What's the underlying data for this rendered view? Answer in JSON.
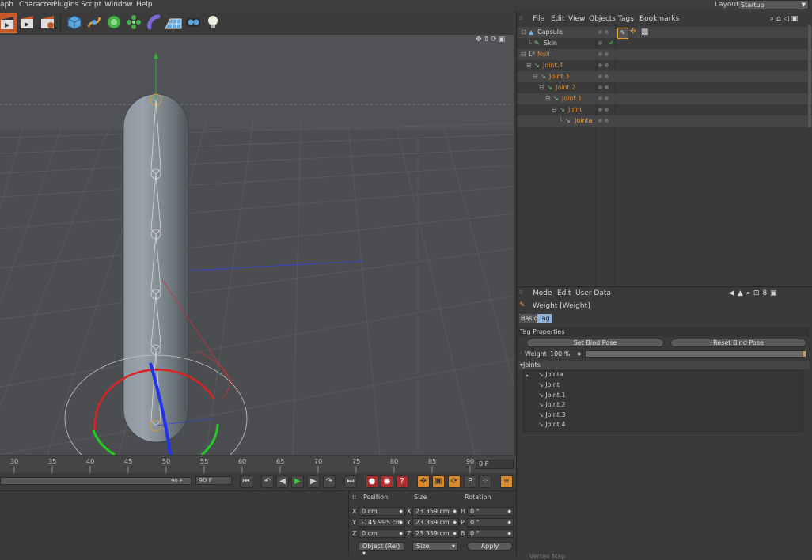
{
  "menubar": {
    "items": [
      "aph",
      "Character",
      "Plugins",
      "Script",
      "Window",
      "Help"
    ],
    "layout_label": "Layout:",
    "layout_value": "Startup"
  },
  "timeline": {
    "ticks": [
      "30",
      "35",
      "40",
      "45",
      "50",
      "55",
      "60",
      "65",
      "70",
      "75",
      "80",
      "85",
      "90"
    ],
    "current_frame": "0 F",
    "scrub_end": "90 F",
    "end_frame": "90 F"
  },
  "coords": {
    "headers": {
      "position": "Position",
      "size": "Size",
      "rotation": "Rotation"
    },
    "rows": [
      {
        "axis": "X",
        "position": "0 cm",
        "size_axis": "X",
        "size": "23.359 cm",
        "rot_axis": "H",
        "rotation": "0 °"
      },
      {
        "axis": "Y",
        "position": "-145.995 cm",
        "size_axis": "Y",
        "size": "23.359 cm",
        "rot_axis": "P",
        "rotation": "0 °"
      },
      {
        "axis": "Z",
        "position": "0 cm",
        "size_axis": "Z",
        "size": "23.359 cm",
        "rot_axis": "B",
        "rotation": "0 °"
      }
    ],
    "mode_select": "Object (Rel)",
    "size_select": "Size",
    "apply": "Apply"
  },
  "objmgr": {
    "menu": [
      "File",
      "Edit",
      "View",
      "Objects",
      "Tags",
      "Bookmarks"
    ],
    "objects": [
      {
        "name": "Capsule",
        "color": "#d8d8d8"
      },
      {
        "name": "Skin",
        "color": "#d8d8d8"
      },
      {
        "name": "Null",
        "color": "#e08a2c"
      },
      {
        "name": "Joint.4",
        "color": "#e08a2c"
      },
      {
        "name": "Joint.3",
        "color": "#e08a2c"
      },
      {
        "name": "Joint.2",
        "color": "#e08a2c"
      },
      {
        "name": "Joint.1",
        "color": "#e08a2c"
      },
      {
        "name": "Joint",
        "color": "#e08a2c"
      },
      {
        "name": "Jointa",
        "color": "#f0a040"
      }
    ]
  },
  "attrmgr": {
    "menu": [
      "Mode",
      "Edit",
      "User Data"
    ],
    "title": "Weight [Weight]",
    "tabs": [
      "Basic",
      "Tag"
    ],
    "section_tag": "Tag Properties",
    "set_bind_pose": "Set Bind Pose",
    "reset_bind_pose": "Reset Bind Pose",
    "weight_label": "Weight",
    "weight_value": "100 %",
    "weight_fraction": 1.0,
    "joints_section": "Joints",
    "joints": [
      "Jointa",
      "Joint",
      "Joint.1",
      "Joint.2",
      "Joint.3",
      "Joint.4"
    ],
    "footer": "Vertex Map"
  },
  "colors": {
    "accent_orange": "#e08a2c",
    "selected_orange": "#f0a040",
    "tag_tab_blue": "#8fb2d8"
  }
}
